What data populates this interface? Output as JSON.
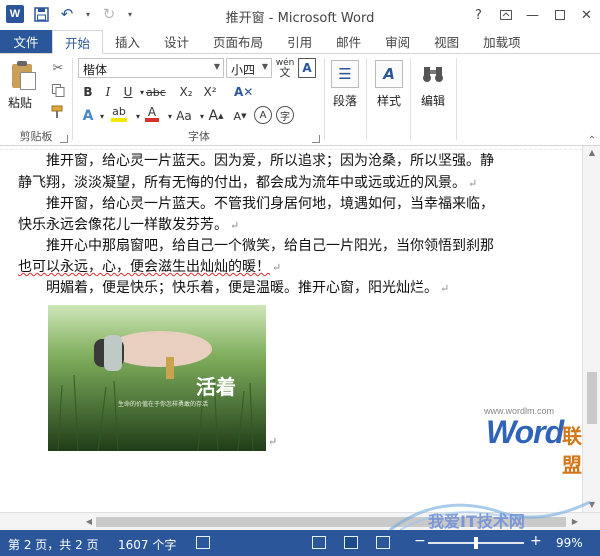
{
  "titlebar": {
    "logo": "W",
    "title": "推开窗 - Microsoft Word",
    "help": "?",
    "controls": [
      "ribbon-display-icon",
      "minimize-icon",
      "maximize-icon",
      "close-icon"
    ]
  },
  "tabs": [
    {
      "label": "文件"
    },
    {
      "label": "开始"
    },
    {
      "label": "插入"
    },
    {
      "label": "设计"
    },
    {
      "label": "页面布局"
    },
    {
      "label": "引用"
    },
    {
      "label": "邮件"
    },
    {
      "label": "审阅"
    },
    {
      "label": "视图"
    },
    {
      "label": "加载项"
    }
  ],
  "ribbon": {
    "clipboard": {
      "paste_label": "粘贴",
      "group_label": "剪贴板"
    },
    "font": {
      "font_name": "楷体",
      "font_size": "小四",
      "phonetic": "wén",
      "group_label": "字体",
      "format_buttons": [
        "B",
        "I",
        "U",
        "abc",
        "X₂",
        "X²"
      ],
      "case_button": "Aa"
    },
    "paragraph": {
      "label": "段落"
    },
    "styles": {
      "label": "样式"
    },
    "editing": {
      "label": "编辑"
    }
  },
  "document": {
    "paragraphs": [
      {
        "text": "推开窗，给心灵一片蓝天。因为爱，所以追求；因为沧桑，所以坚强。静"
      },
      {
        "text": "静飞翔，淡淡凝望，所有无悔的付出，都会成为流年中或远或近的风景。"
      },
      {
        "text": "推开窗，给心灵一片蓝天。不管我们身居何地，境遇如何，当幸福来临，"
      },
      {
        "text": "快乐永远会像花儿一样散发芬芳。"
      },
      {
        "text": "推开心中那扇窗吧，给自己一个微笑，给自己一片阳光，当你领悟到刹那"
      },
      {
        "text": "也可以永远，心，便会滋生出灿灿的暖！"
      },
      {
        "text": "明媚着，便是快乐；快乐着，便是温暖。推开心窗，阳光灿烂。"
      }
    ],
    "pilcrow": "↵",
    "image": {
      "title": "活着",
      "subtitle": "生命的价值在于你怎样勇敢的存活"
    },
    "watermark": {
      "url": "www.wordlm.com",
      "logo_word": "Word",
      "logo_cn": "联盟"
    }
  },
  "status": {
    "page": "第 2 页，共 2 页",
    "words": "1607 个字",
    "zoom": "99%",
    "zoom_level": 0.99
  },
  "bottom_watermark": "我爱IT技术网"
}
